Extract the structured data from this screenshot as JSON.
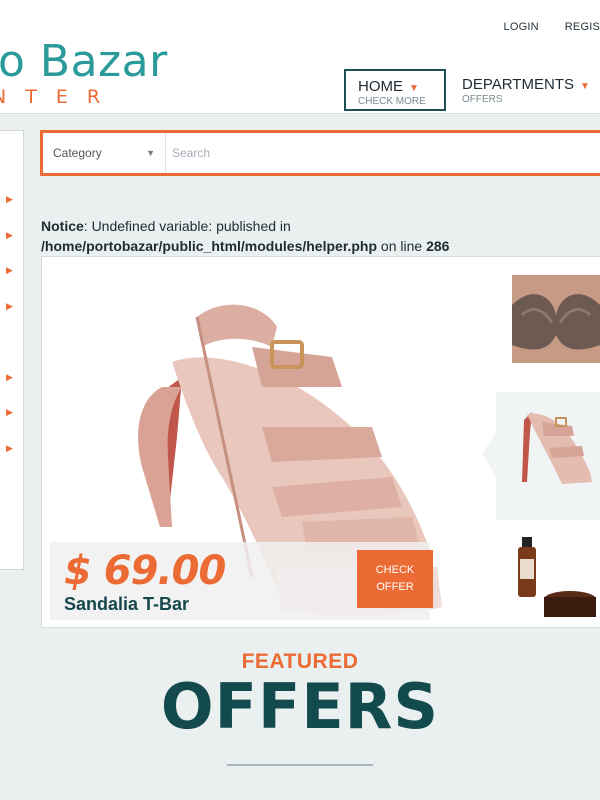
{
  "header": {
    "logo_main": "o Bazar",
    "logo_sub": "NTER",
    "top_links": [
      "LOGIN",
      "REGIS"
    ],
    "nav": [
      {
        "title": "HOME",
        "sub": "CHECK MORE"
      },
      {
        "title": "DEPARTMENTS",
        "sub": "OFFERS"
      }
    ]
  },
  "search": {
    "category_label": "Category",
    "placeholder": "Search"
  },
  "notice": {
    "label": "Notice",
    "text": ": Undefined variable: published in ",
    "path": "/home/portobazar/public_html/modules/helper.php",
    "line_text": " on line ",
    "line": "286"
  },
  "product": {
    "price": "$ 69.00",
    "name": "Sandalia T-Bar",
    "cta": "CHECK OFFER"
  },
  "featured": {
    "kicker": "FEATURED",
    "title": "OFFERS"
  },
  "colors": {
    "accent": "#ec6a34",
    "brand_teal": "#2a9a9a",
    "dark_teal": "#134a4e"
  }
}
